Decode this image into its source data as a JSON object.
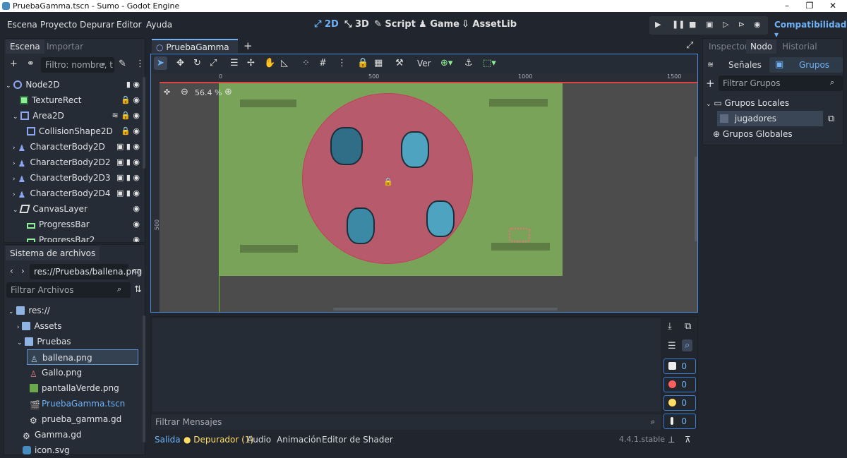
{
  "window": {
    "title": "PruebaGamma.tscn - Sumo - Godot Engine"
  },
  "menu": {
    "items": [
      "Escena",
      "Proyecto",
      "Depurar",
      "Editor",
      "Ayuda"
    ]
  },
  "workspaces": [
    "2D",
    "3D",
    "Script",
    "Game",
    "AssetLib"
  ],
  "renderer": "Compatibilidad",
  "scene_panel": {
    "tabs": [
      "Escena",
      "Importar"
    ],
    "filter_placeholder": "Filtro: nombre, t",
    "nodes": [
      {
        "name": "Node2D",
        "icon": "node2d-icon"
      },
      {
        "name": "TextureRect",
        "icon": "texture-rect-icon"
      },
      {
        "name": "Area2D",
        "icon": "area2d-icon"
      },
      {
        "name": "CollisionShape2D",
        "icon": "collision-shape-icon"
      },
      {
        "name": "CharacterBody2D",
        "icon": "character-body-icon"
      },
      {
        "name": "CharacterBody2D2",
        "icon": "character-body-icon"
      },
      {
        "name": "CharacterBody2D3",
        "icon": "character-body-icon"
      },
      {
        "name": "CharacterBody2D4",
        "icon": "character-body-icon"
      },
      {
        "name": "CanvasLayer",
        "icon": "canvas-layer-icon"
      },
      {
        "name": "ProgressBar",
        "icon": "progress-bar-icon"
      },
      {
        "name": "ProgressBar2",
        "icon": "progress-bar-icon"
      }
    ]
  },
  "filesystem": {
    "title": "Sistema de archivos",
    "path": "res://Pruebas/ballena.png",
    "filter_placeholder": "Filtrar Archivos",
    "items": [
      "res://",
      "Assets",
      "Pruebas",
      "ballena.png",
      "Gallo.png",
      "pantallaVerde.png",
      "PruebaGamma.tscn",
      "prueba_gamma.gd",
      "Gamma.gd",
      "icon.svg"
    ]
  },
  "editor": {
    "scene_tab": "PruebaGamma",
    "view_label": "Ver",
    "zoom": "56.4 %",
    "ruler_ticks": [
      "0",
      "500",
      "1000",
      "1500"
    ],
    "vruler_tick": "500"
  },
  "output": {
    "filter_placeholder": "Filtrar Mensajes",
    "counters": [
      "0",
      "0",
      "0",
      "0"
    ],
    "bottom_tabs": [
      "Salida",
      "Depurador (1)",
      "Audio",
      "Animación",
      "Editor de Shader"
    ],
    "version": "4.4.1.stable"
  },
  "node_panel": {
    "tabs": [
      "Inspector",
      "Nodo",
      "Historial"
    ],
    "subtabs": [
      "Señales",
      "Grupos"
    ],
    "filter_placeholder": "Filtrar Grupos",
    "local_groups": "Grupos Locales",
    "group_item": "jugadores",
    "global_groups": "Grupos Globales"
  },
  "colors": {
    "accent": "#6eb2f5",
    "bg": "#21262e",
    "panel": "#262c35",
    "arena": "#b65a6c",
    "field": "#7aa35a"
  }
}
